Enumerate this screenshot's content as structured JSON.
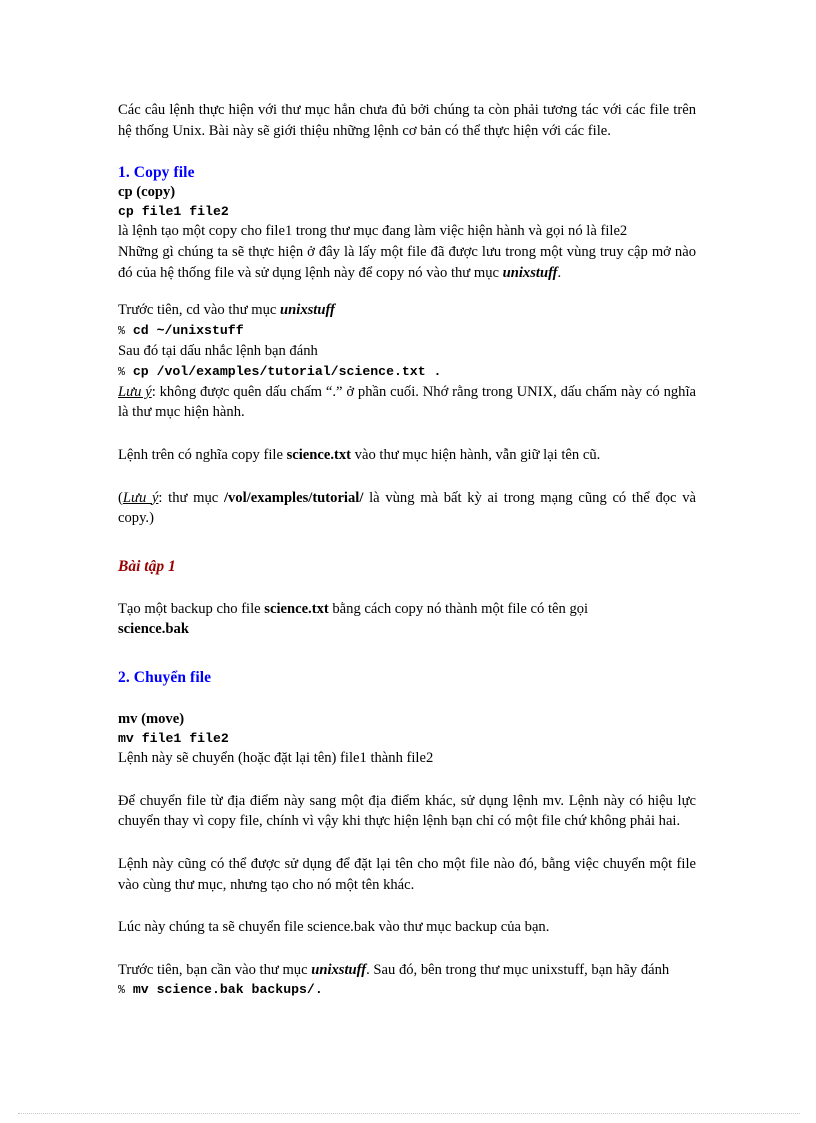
{
  "document": {
    "intro": {
      "text": "Các câu lệnh thực hiện với thư mục hẳn chưa đủ bởi chúng ta còn phải tương tác với các file trên hệ thống Unix. Bài này sẽ giới thiệu những lệnh cơ bản có thể thực hiện với các file."
    },
    "section_1": {
      "heading": "1. Copy file",
      "command_name": "cp (copy)",
      "command_syntax": "cp file1 file2",
      "description_line_1": "là lệnh tạo một copy cho file1 trong thư mục đang làm việc hiện hành và gọi nó là file2",
      "description_line_2_a": "Những gì chúng ta sẽ thực hiện ở đây là lấy một file đã được lưu trong một vùng truy cập mở nào đó của hệ thống file và sử dụng lệnh này để copy nó vào thư mục ",
      "description_line_2_dir": "unixstuff",
      "description_line_2_b": ".",
      "step_1_a": "Trước tiên, cd vào thư mục ",
      "step_1_dir": "unixstuff",
      "prompt": "%",
      "cmd_cd": "cd ~/unixstuff",
      "step_2": "Sau đó tại dấu nhắc lệnh bạn đánh",
      "cmd_cp": "cp /vol/examples/tutorial/science.txt .",
      "note_label": "Lưu ý",
      "note_text": ": không được quên dấu chấm “.” ở phần cuối. Nhớ rằng trong UNIX, dấu chấm này có nghĩa là thư mục hiện hành.",
      "meaning_a": "Lệnh trên có nghĩa copy file ",
      "meaning_file": "science.txt",
      "meaning_b": " vào thư mục hiện hành, vẫn giữ lại tên cũ.",
      "note2_open": "(",
      "note2_label": "Lưu ý",
      "note2_a": ": thư mục ",
      "note2_path": "/vol/examples/tutorial/",
      "note2_b": " là vùng mà bất kỳ ai trong mạng cũng có thể đọc và copy.)"
    },
    "exercise": {
      "heading": "Bài tập 1",
      "text_a": "Tạo một backup cho file ",
      "file_src": "science.txt",
      "text_b": " bằng cách copy nó thành một file có tên gọi",
      "file_dst": "science.bak"
    },
    "section_2": {
      "heading": "2. Chuyển file",
      "command_name": "mv (move)",
      "command_syntax": "mv file1 file2",
      "description_line_1": "Lệnh này sẽ chuyển (hoặc đặt lại tên) file1 thành file2",
      "paragraph_1": "Để chuyển file từ địa điểm này sang một địa điểm khác, sử dụng lệnh mv. Lệnh này có hiệu lực chuyển thay vì copy file, chính vì vậy khi thực hiện lệnh bạn chỉ có một file chứ không phải hai.",
      "paragraph_2": "Lệnh này cũng có thể được sử dụng để đặt lại tên cho một file nào đó, bằng việc chuyển một file vào cùng thư mục, nhưng tạo cho nó một tên khác.",
      "paragraph_3": "Lúc này chúng ta sẽ chuyển file science.bak vào thư mục backup của bạn.",
      "step_a": "Trước tiên, bạn cần vào thư mục ",
      "step_dir": "unixstuff",
      "step_b": ". Sau đó, bên trong thư mục unixstuff,  bạn hãy đánh",
      "prompt": "%",
      "cmd_mv": "mv science.bak backups/."
    },
    "colors": {
      "heading_blue": "#0000ff",
      "heading_red": "#990000",
      "body_text": "#000000",
      "page_background": "#ffffff",
      "footer_rule": "#c9c9c9"
    }
  }
}
